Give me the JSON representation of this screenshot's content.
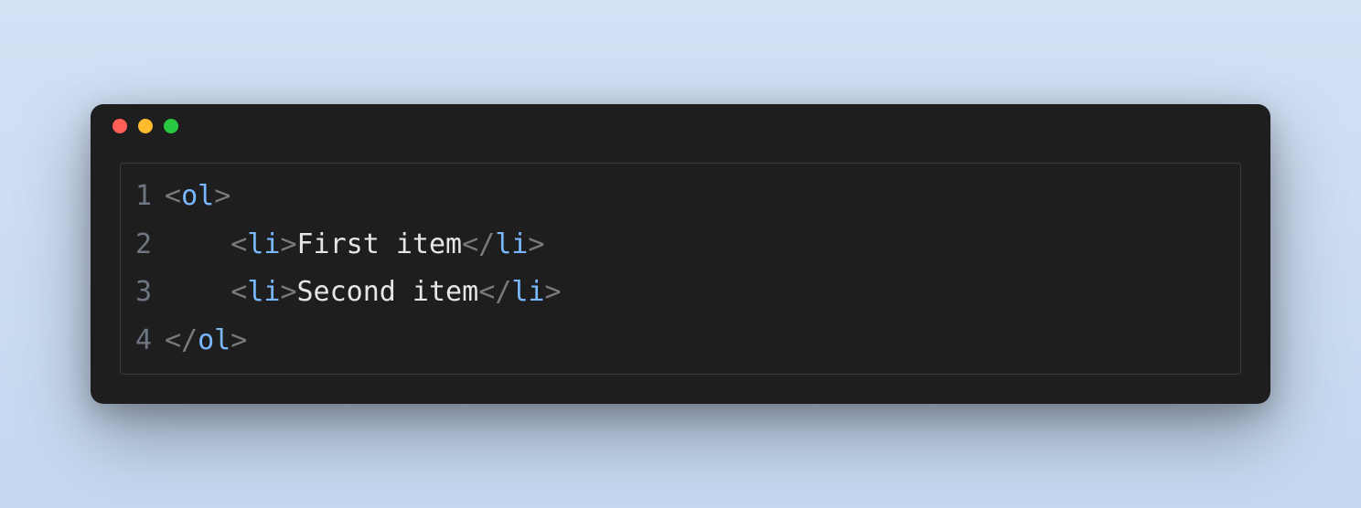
{
  "window": {
    "traffic_lights": [
      "close",
      "minimize",
      "zoom"
    ]
  },
  "code": {
    "lines": [
      {
        "num": "1",
        "segments": [
          {
            "type": "ang",
            "text": "<"
          },
          {
            "type": "tag",
            "text": "ol"
          },
          {
            "type": "ang",
            "text": ">"
          }
        ]
      },
      {
        "num": "2",
        "segments": [
          {
            "type": "txt",
            "text": "    "
          },
          {
            "type": "ang",
            "text": "<"
          },
          {
            "type": "tag",
            "text": "li"
          },
          {
            "type": "ang",
            "text": ">"
          },
          {
            "type": "txt",
            "text": "First item"
          },
          {
            "type": "ang",
            "text": "</"
          },
          {
            "type": "tag",
            "text": "li"
          },
          {
            "type": "ang",
            "text": ">"
          }
        ]
      },
      {
        "num": "3",
        "segments": [
          {
            "type": "txt",
            "text": "    "
          },
          {
            "type": "ang",
            "text": "<"
          },
          {
            "type": "tag",
            "text": "li"
          },
          {
            "type": "ang",
            "text": ">"
          },
          {
            "type": "txt",
            "text": "Second item"
          },
          {
            "type": "ang",
            "text": "</"
          },
          {
            "type": "tag",
            "text": "li"
          },
          {
            "type": "ang",
            "text": ">"
          }
        ]
      },
      {
        "num": "4",
        "segments": [
          {
            "type": "ang",
            "text": "</"
          },
          {
            "type": "tag",
            "text": "ol"
          },
          {
            "type": "ang",
            "text": ">"
          }
        ]
      }
    ]
  }
}
